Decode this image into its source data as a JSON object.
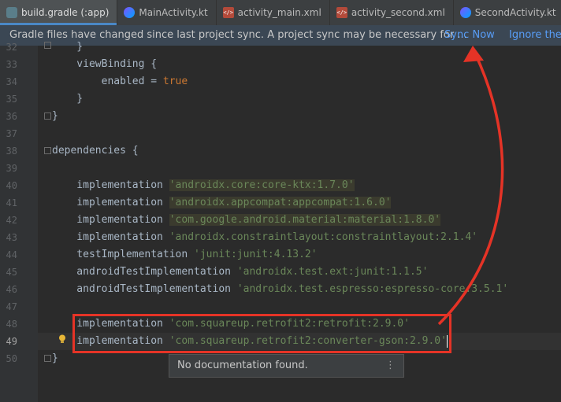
{
  "tabs": [
    {
      "label": "build.gradle (:app)",
      "icon": "gradle-icon",
      "active": true
    },
    {
      "label": "MainActivity.kt",
      "icon": "kotlin-file-icon"
    },
    {
      "label": "activity_main.xml",
      "icon": "xml-file-icon"
    },
    {
      "label": "activity_second.xml",
      "icon": "xml-file-icon"
    },
    {
      "label": "SecondActivity.kt",
      "icon": "kotlin-file-icon"
    }
  ],
  "notification": {
    "message": "Gradle files have changed since last project sync. A project sync may be necessary for ...",
    "sync_now": "Sync Now",
    "ignore": "Ignore thes"
  },
  "code_lines": [
    {
      "num": "32",
      "text": "    }"
    },
    {
      "num": "33",
      "text": "    viewBinding {"
    },
    {
      "num": "34",
      "text": "        enabled = "
    },
    {
      "num": "35",
      "text": "    }"
    },
    {
      "num": "36",
      "text": "}"
    },
    {
      "num": "37",
      "text": ""
    },
    {
      "num": "38",
      "text": "dependencies {"
    },
    {
      "num": "39",
      "text": ""
    },
    {
      "num": "40",
      "text": "    implementation "
    },
    {
      "num": "41",
      "text": "    implementation "
    },
    {
      "num": "42",
      "text": "    implementation "
    },
    {
      "num": "43",
      "text": "    implementation "
    },
    {
      "num": "44",
      "text": "    testImplementation "
    },
    {
      "num": "45",
      "text": "    androidTestImplementation "
    },
    {
      "num": "46",
      "text": "    androidTestImplementation "
    },
    {
      "num": "47",
      "text": ""
    },
    {
      "num": "48",
      "text": "    implementation "
    },
    {
      "num": "49",
      "text": "    implementation "
    },
    {
      "num": "50",
      "text": "}"
    }
  ],
  "code_values": {
    "true_kw": "true",
    "dep40": "'androidx.core:core-ktx:1.7.0'",
    "dep41": "'androidx.appcompat:appcompat:1.6.0'",
    "dep42": "'com.google.android.material:material:1.8.0'",
    "dep43": "'androidx.constraintlayout:constraintlayout:2.1.4'",
    "dep44": "'junit:junit:4.13.2'",
    "dep45": "'androidx.test.ext:junit:1.1.5'",
    "dep46": "'androidx.test.espresso:espresso-core:3.5.1'",
    "dep48": "'com.squareup.retrofit2:retrofit:2.9.0'",
    "dep49": "'com.squareup.retrofit2:converter-gson:2.9.0'"
  },
  "popup": {
    "text": "No documentation found.",
    "menu": "⋮"
  },
  "colors": {
    "annotation": "#e53326",
    "link": "#589df6"
  }
}
